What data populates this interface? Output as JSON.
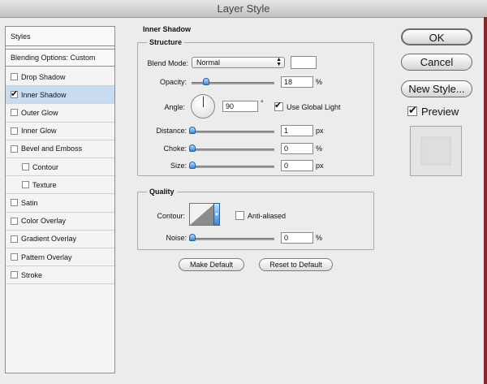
{
  "window": {
    "title": "Layer Style"
  },
  "styles_list": {
    "header": "Styles",
    "blending": "Blending Options: Custom",
    "items": [
      {
        "label": "Drop Shadow",
        "checked": false,
        "selected": false,
        "indent": false
      },
      {
        "label": "Inner Shadow",
        "checked": true,
        "selected": true,
        "indent": false
      },
      {
        "label": "Outer Glow",
        "checked": false,
        "selected": false,
        "indent": false
      },
      {
        "label": "Inner Glow",
        "checked": false,
        "selected": false,
        "indent": false
      },
      {
        "label": "Bevel and Emboss",
        "checked": false,
        "selected": false,
        "indent": false
      },
      {
        "label": "Contour",
        "checked": false,
        "selected": false,
        "indent": true
      },
      {
        "label": "Texture",
        "checked": false,
        "selected": false,
        "indent": true
      },
      {
        "label": "Satin",
        "checked": false,
        "selected": false,
        "indent": false
      },
      {
        "label": "Color Overlay",
        "checked": false,
        "selected": false,
        "indent": false
      },
      {
        "label": "Gradient Overlay",
        "checked": false,
        "selected": false,
        "indent": false
      },
      {
        "label": "Pattern Overlay",
        "checked": false,
        "selected": false,
        "indent": false
      },
      {
        "label": "Stroke",
        "checked": false,
        "selected": false,
        "indent": false
      }
    ]
  },
  "panel": {
    "title": "Inner Shadow",
    "structure": {
      "title": "Structure",
      "blend_mode_label": "Blend Mode:",
      "blend_mode_value": "Normal",
      "opacity_label": "Opacity:",
      "opacity_value": "18",
      "opacity_unit": "%",
      "opacity_fraction": 0.18,
      "angle_label": "Angle:",
      "angle_value": "90",
      "angle_unit": "°",
      "use_global_light_label": "Use Global Light",
      "use_global_light": true,
      "distance_label": "Distance:",
      "distance_value": "1",
      "distance_unit": "px",
      "choke_label": "Choke:",
      "choke_value": "0",
      "choke_unit": "%",
      "size_label": "Size:",
      "size_value": "0",
      "size_unit": "px"
    },
    "quality": {
      "title": "Quality",
      "contour_label": "Contour:",
      "anti_aliased_label": "Anti-aliased",
      "anti_aliased": false,
      "noise_label": "Noise:",
      "noise_value": "0",
      "noise_unit": "%"
    },
    "make_default": "Make Default",
    "reset_to_default": "Reset to Default"
  },
  "buttons": {
    "ok": "OK",
    "cancel": "Cancel",
    "new_style": "New Style...",
    "preview_label": "Preview",
    "preview": true
  },
  "colors": {
    "selection": "#c9dcef",
    "slider": "#3a86d1"
  }
}
